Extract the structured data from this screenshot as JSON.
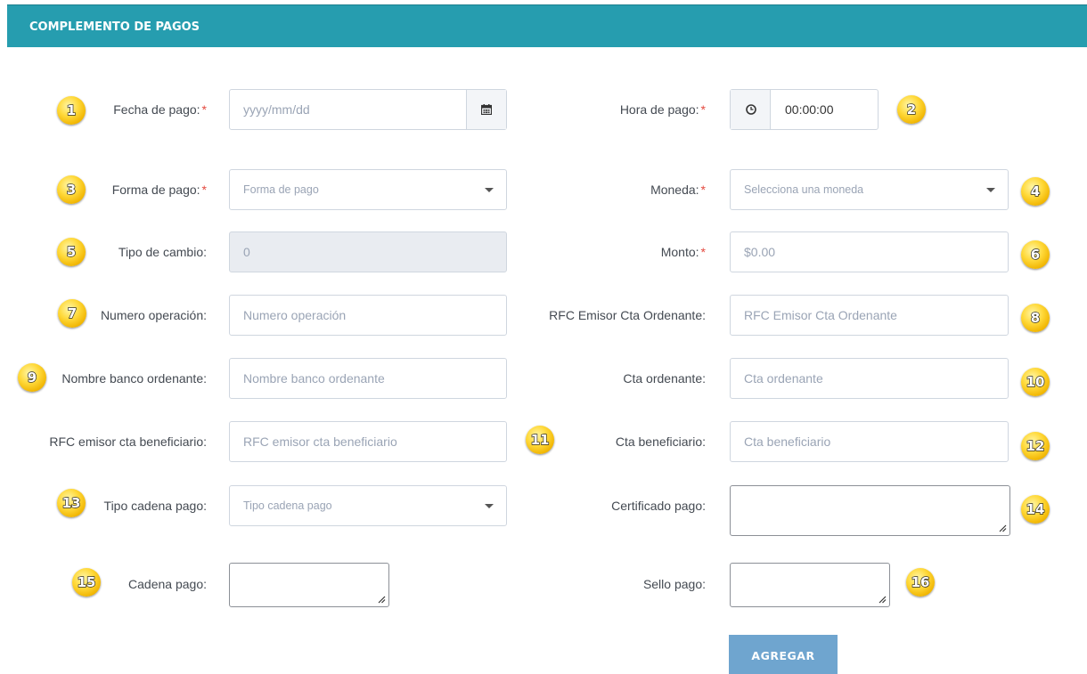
{
  "header": {
    "title": "COMPLEMENTO DE PAGOS"
  },
  "fields": {
    "fecha_pago": {
      "label": "Fecha de pago:",
      "required": "*",
      "placeholder": "yyyy/mm/dd",
      "icon": "calendar-icon"
    },
    "hora_pago": {
      "label": "Hora de pago:",
      "required": "*",
      "value": "00:00:00",
      "icon": "clock-icon"
    },
    "forma_pago": {
      "label": "Forma de pago:",
      "required": "*",
      "placeholder": "Forma de pago"
    },
    "moneda": {
      "label": "Moneda:",
      "required": "*",
      "placeholder": "Selecciona una moneda"
    },
    "tipo_cambio": {
      "label": "Tipo de cambio:",
      "value": "0"
    },
    "monto": {
      "label": "Monto:",
      "required": "*",
      "placeholder": "$0.00"
    },
    "numero_operacion": {
      "label": "Numero operación:",
      "placeholder": "Numero operación"
    },
    "rfc_emisor_ordenante": {
      "label": "RFC Emisor Cta Ordenante:",
      "placeholder": "RFC Emisor Cta Ordenante"
    },
    "nombre_banco": {
      "label": "Nombre banco ordenante:",
      "placeholder": "Nombre banco ordenante"
    },
    "cta_ordenante": {
      "label": "Cta ordenante:",
      "placeholder": "Cta ordenante"
    },
    "rfc_beneficiario": {
      "label": "RFC emisor cta beneficiario:",
      "placeholder": "RFC emisor cta beneficiario"
    },
    "cta_beneficiario": {
      "label": "Cta beneficiario:",
      "placeholder": "Cta beneficiario"
    },
    "tipo_cadena": {
      "label": "Tipo cadena pago:",
      "placeholder": "Tipo cadena pago"
    },
    "certificado_pago": {
      "label": "Certificado pago:"
    },
    "cadena_pago": {
      "label": "Cadena pago:"
    },
    "sello_pago": {
      "label": "Sello pago:"
    }
  },
  "badges": [
    "1",
    "2",
    "3",
    "4",
    "5",
    "6",
    "7",
    "8",
    "9",
    "10",
    "11",
    "12",
    "13",
    "14",
    "15",
    "16"
  ],
  "button": {
    "label": "AGREGAR"
  },
  "colors": {
    "header": "#269daf",
    "button": "#6fa5cf",
    "required": "#e4493f",
    "badge": "#ffd93a"
  }
}
